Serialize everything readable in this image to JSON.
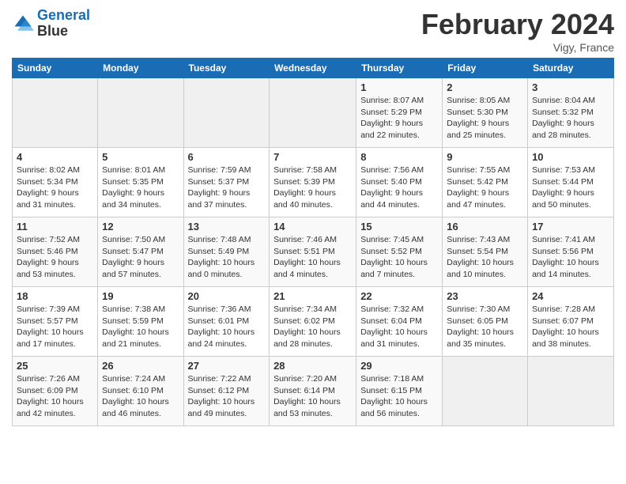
{
  "header": {
    "logo_line1": "General",
    "logo_line2": "Blue",
    "month_title": "February 2024",
    "location": "Vigy, France"
  },
  "weekdays": [
    "Sunday",
    "Monday",
    "Tuesday",
    "Wednesday",
    "Thursday",
    "Friday",
    "Saturday"
  ],
  "weeks": [
    [
      {
        "day": "",
        "info": ""
      },
      {
        "day": "",
        "info": ""
      },
      {
        "day": "",
        "info": ""
      },
      {
        "day": "",
        "info": ""
      },
      {
        "day": "1",
        "info": "Sunrise: 8:07 AM\nSunset: 5:29 PM\nDaylight: 9 hours\nand 22 minutes."
      },
      {
        "day": "2",
        "info": "Sunrise: 8:05 AM\nSunset: 5:30 PM\nDaylight: 9 hours\nand 25 minutes."
      },
      {
        "day": "3",
        "info": "Sunrise: 8:04 AM\nSunset: 5:32 PM\nDaylight: 9 hours\nand 28 minutes."
      }
    ],
    [
      {
        "day": "4",
        "info": "Sunrise: 8:02 AM\nSunset: 5:34 PM\nDaylight: 9 hours\nand 31 minutes."
      },
      {
        "day": "5",
        "info": "Sunrise: 8:01 AM\nSunset: 5:35 PM\nDaylight: 9 hours\nand 34 minutes."
      },
      {
        "day": "6",
        "info": "Sunrise: 7:59 AM\nSunset: 5:37 PM\nDaylight: 9 hours\nand 37 minutes."
      },
      {
        "day": "7",
        "info": "Sunrise: 7:58 AM\nSunset: 5:39 PM\nDaylight: 9 hours\nand 40 minutes."
      },
      {
        "day": "8",
        "info": "Sunrise: 7:56 AM\nSunset: 5:40 PM\nDaylight: 9 hours\nand 44 minutes."
      },
      {
        "day": "9",
        "info": "Sunrise: 7:55 AM\nSunset: 5:42 PM\nDaylight: 9 hours\nand 47 minutes."
      },
      {
        "day": "10",
        "info": "Sunrise: 7:53 AM\nSunset: 5:44 PM\nDaylight: 9 hours\nand 50 minutes."
      }
    ],
    [
      {
        "day": "11",
        "info": "Sunrise: 7:52 AM\nSunset: 5:46 PM\nDaylight: 9 hours\nand 53 minutes."
      },
      {
        "day": "12",
        "info": "Sunrise: 7:50 AM\nSunset: 5:47 PM\nDaylight: 9 hours\nand 57 minutes."
      },
      {
        "day": "13",
        "info": "Sunrise: 7:48 AM\nSunset: 5:49 PM\nDaylight: 10 hours\nand 0 minutes."
      },
      {
        "day": "14",
        "info": "Sunrise: 7:46 AM\nSunset: 5:51 PM\nDaylight: 10 hours\nand 4 minutes."
      },
      {
        "day": "15",
        "info": "Sunrise: 7:45 AM\nSunset: 5:52 PM\nDaylight: 10 hours\nand 7 minutes."
      },
      {
        "day": "16",
        "info": "Sunrise: 7:43 AM\nSunset: 5:54 PM\nDaylight: 10 hours\nand 10 minutes."
      },
      {
        "day": "17",
        "info": "Sunrise: 7:41 AM\nSunset: 5:56 PM\nDaylight: 10 hours\nand 14 minutes."
      }
    ],
    [
      {
        "day": "18",
        "info": "Sunrise: 7:39 AM\nSunset: 5:57 PM\nDaylight: 10 hours\nand 17 minutes."
      },
      {
        "day": "19",
        "info": "Sunrise: 7:38 AM\nSunset: 5:59 PM\nDaylight: 10 hours\nand 21 minutes."
      },
      {
        "day": "20",
        "info": "Sunrise: 7:36 AM\nSunset: 6:01 PM\nDaylight: 10 hours\nand 24 minutes."
      },
      {
        "day": "21",
        "info": "Sunrise: 7:34 AM\nSunset: 6:02 PM\nDaylight: 10 hours\nand 28 minutes."
      },
      {
        "day": "22",
        "info": "Sunrise: 7:32 AM\nSunset: 6:04 PM\nDaylight: 10 hours\nand 31 minutes."
      },
      {
        "day": "23",
        "info": "Sunrise: 7:30 AM\nSunset: 6:05 PM\nDaylight: 10 hours\nand 35 minutes."
      },
      {
        "day": "24",
        "info": "Sunrise: 7:28 AM\nSunset: 6:07 PM\nDaylight: 10 hours\nand 38 minutes."
      }
    ],
    [
      {
        "day": "25",
        "info": "Sunrise: 7:26 AM\nSunset: 6:09 PM\nDaylight: 10 hours\nand 42 minutes."
      },
      {
        "day": "26",
        "info": "Sunrise: 7:24 AM\nSunset: 6:10 PM\nDaylight: 10 hours\nand 46 minutes."
      },
      {
        "day": "27",
        "info": "Sunrise: 7:22 AM\nSunset: 6:12 PM\nDaylight: 10 hours\nand 49 minutes."
      },
      {
        "day": "28",
        "info": "Sunrise: 7:20 AM\nSunset: 6:14 PM\nDaylight: 10 hours\nand 53 minutes."
      },
      {
        "day": "29",
        "info": "Sunrise: 7:18 AM\nSunset: 6:15 PM\nDaylight: 10 hours\nand 56 minutes."
      },
      {
        "day": "",
        "info": ""
      },
      {
        "day": "",
        "info": ""
      }
    ]
  ]
}
